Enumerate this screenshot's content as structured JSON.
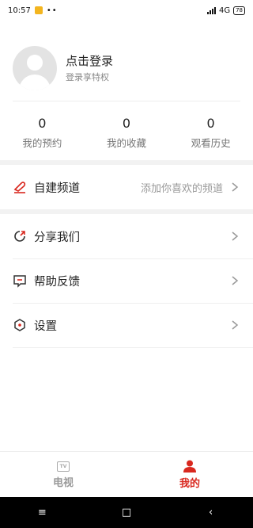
{
  "status_bar": {
    "time": "10:57",
    "dots": "••",
    "network": "4G",
    "battery": "78",
    "icons": [
      "notification-icon",
      "signal-icon",
      "battery-icon"
    ]
  },
  "profile": {
    "title": "点击登录",
    "subtitle": "登录享特权"
  },
  "stats": [
    {
      "value": "0",
      "label": "我的预约"
    },
    {
      "value": "0",
      "label": "我的收藏"
    },
    {
      "value": "0",
      "label": "观看历史"
    }
  ],
  "custom_channel": {
    "label": "自建频道",
    "hint": "添加你喜欢的频道",
    "icon": "pen-icon"
  },
  "menu": [
    {
      "label": "分享我们",
      "icon": "share-icon"
    },
    {
      "label": "帮助反馈",
      "icon": "feedback-icon"
    },
    {
      "label": "设置",
      "icon": "settings-icon"
    }
  ],
  "tabs": [
    {
      "label": "电视",
      "icon_text": "TV",
      "icon": "tv-icon",
      "active": false
    },
    {
      "label": "我的",
      "icon": "person-icon",
      "active": true
    }
  ],
  "nav": {
    "menu": "≡",
    "home": "□",
    "back": "‹"
  },
  "colors": {
    "accent": "#d9281f",
    "muted": "#999999",
    "separator": "#f2f2f2"
  }
}
